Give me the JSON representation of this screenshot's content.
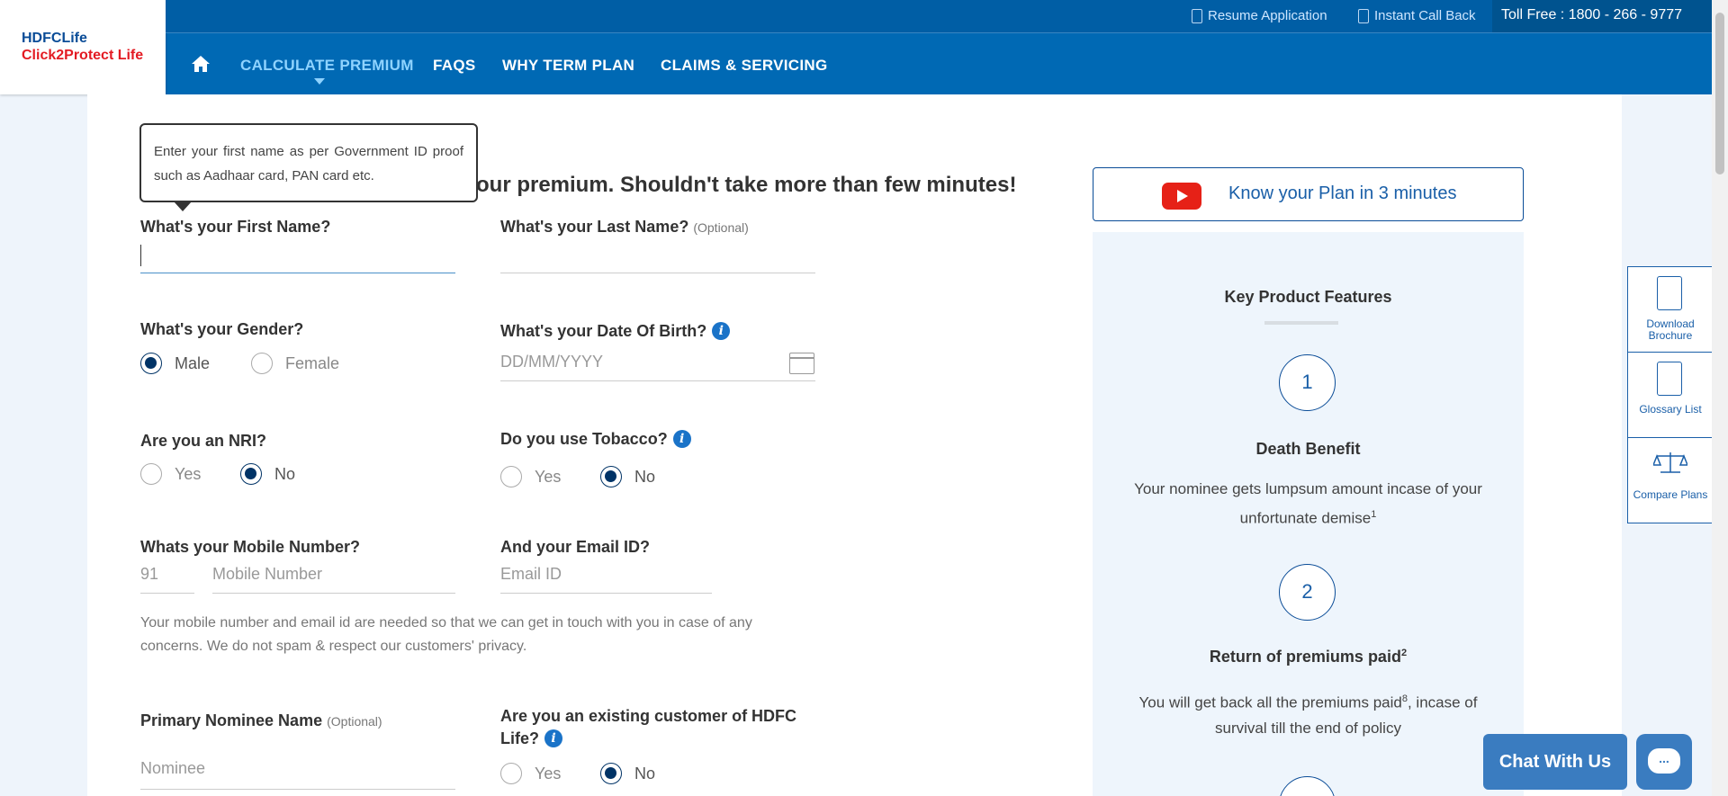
{
  "logo": {
    "line1_brand": "HDFC",
    "line1_suffix": "Life",
    "line2": "Click2Protect Life"
  },
  "topbar": {
    "resume_application": "Resume Application",
    "instant_call_back": "Instant Call Back",
    "toll_free": "Toll Free : 1800 - 266 - 9777"
  },
  "nav": {
    "items": [
      "CALCULATE PREMIUM",
      "FAQS",
      "WHY TERM PLAN",
      "CLAIMS & SERVICING"
    ],
    "active": "CALCULATE PREMIUM"
  },
  "tooltip": {
    "text": "Enter your first name as per Government ID proof such as Aadhaar card, PAN card etc."
  },
  "heading": "our premium. Shouldn't take more than few minutes!",
  "form": {
    "first_name": {
      "label": "What's your First Name?",
      "value": ""
    },
    "last_name": {
      "label": "What's your Last Name?",
      "optional": "(Optional)",
      "value": ""
    },
    "gender": {
      "label": "What's your Gender?",
      "options": [
        "Male",
        "Female"
      ],
      "selected": "Male"
    },
    "dob": {
      "label": "What's your Date Of Birth?",
      "placeholder": "DD/MM/YYYY"
    },
    "nri": {
      "label": "Are you an NRI?",
      "options": [
        "Yes",
        "No"
      ],
      "selected": "No"
    },
    "tobacco": {
      "label": "Do you use Tobacco?",
      "options": [
        "Yes",
        "No"
      ],
      "selected": "No"
    },
    "mobile": {
      "label": "Whats your Mobile Number?",
      "country_code": "91",
      "placeholder": "Mobile Number"
    },
    "email": {
      "label": "And your Email ID?",
      "placeholder": "Email ID"
    },
    "privacy_note": "Your mobile number and email id are needed so that we can get in touch with you in case of any concerns. We do not spam & respect our customers' privacy.",
    "nominee": {
      "label": "Primary Nominee Name",
      "optional": "(Optional)",
      "placeholder": "Nominee"
    },
    "existing_customer": {
      "label": "Are you an existing customer of HDFC Life?",
      "options": [
        "Yes",
        "No"
      ],
      "selected": "No"
    }
  },
  "video": {
    "label": "Know your Plan in 3 minutes"
  },
  "features": {
    "title": "Key Product Features",
    "items": [
      {
        "number": "1",
        "title": "Death Benefit",
        "text": "Your nominee gets lumpsum amount incase of your unfortunate demise",
        "sup": "1"
      },
      {
        "number": "2",
        "title": "Return of premiums paid",
        "title_sup": "2",
        "text_a": "You will get back all the premiums paid",
        "text_sup": "8",
        "text_b": ", incase of survival till the end of policy"
      }
    ]
  },
  "side_tools": [
    "Download Brochure",
    "Glossary List",
    "Compare Plans"
  ],
  "chat": {
    "label": "Chat With Us",
    "bubble": "..."
  },
  "colors": {
    "brand_blue": "#0069b4",
    "selected_radio": "#003366",
    "youtube_red": "#e62117"
  }
}
